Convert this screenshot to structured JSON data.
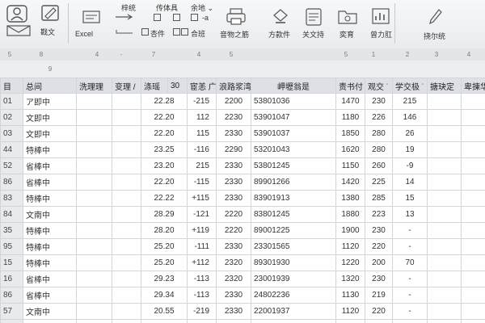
{
  "ribbon": {
    "group_tabs": [
      "梓统",
      "传体具",
      "余地 ⌄"
    ],
    "left_buttons": [
      {
        "label": ""
      },
      {
        "label": "戡文"
      }
    ],
    "excel_label": "Excel",
    "small_controls": [
      "杏件",
      "合班",
      "-a"
    ],
    "buttons": [
      {
        "label": "音物之筋"
      },
      {
        "label": "方款件"
      },
      {
        "label": "关文持"
      },
      {
        "label": "奕育"
      },
      {
        "label": "曾力肛"
      },
      {
        "label": "挠尔统"
      }
    ]
  },
  "index_row": [
    "5",
    "8",
    "4",
    "-",
    "7",
    "4",
    "5",
    "5",
    "1",
    "2",
    "3",
    "4"
  ],
  "col_letters": [
    "9"
  ],
  "table": {
    "headers": [
      "目",
      "总间",
      "洗理理",
      "变理 /",
      "涤瑶",
      "30",
      "宦恙 广",
      "浪路浆湾",
      "岬壢翁是",
      "责书付",
      "观交 ˙",
      "学交极 ˙",
      "搪玦定",
      "卑揀华"
    ],
    "rows": [
      {
        "n": "01",
        "name": "ア即中",
        "a": "22.28",
        "b": "-215",
        "c": "2200",
        "code": "53801036",
        "d": "1470",
        "e": "230",
        "f": "215"
      },
      {
        "n": "02",
        "name": "文即中",
        "a": "22.20",
        "b": "112",
        "c": "2230",
        "code": "53901047",
        "d": "1180",
        "e": "226",
        "f": "146"
      },
      {
        "n": "03",
        "name": "文即中",
        "a": "22.20",
        "b": "115",
        "c": "2330",
        "code": "53901037",
        "d": "1850",
        "e": "280",
        "f": "26"
      },
      {
        "n": "44",
        "name": "特棒中",
        "a": "23.25",
        "b": "-116",
        "c": "2290",
        "code": "53201043",
        "d": "1620",
        "e": "280",
        "f": "19"
      },
      {
        "n": "52",
        "name": "省棒中",
        "a": "23.20",
        "b": "215",
        "c": "2330",
        "code": "53801245",
        "d": "1150",
        "e": "260",
        "f": "-9"
      },
      {
        "n": "86",
        "name": "省棒中",
        "a": "22.20",
        "b": "-115",
        "c": "2330",
        "code": "89901266",
        "d": "1420",
        "e": "225",
        "f": "14"
      },
      {
        "n": "83",
        "name": "特棒中",
        "a": "22.22",
        "b": "+115",
        "c": "2330",
        "code": "83901913",
        "d": "1380",
        "e": "285",
        "f": "15"
      },
      {
        "n": "84",
        "name": "文南中",
        "a": "28.29",
        "b": "-121",
        "c": "2220",
        "code": "83801245",
        "d": "1880",
        "e": "223",
        "f": "13"
      },
      {
        "n": "35",
        "name": "特棒中",
        "a": "28.20",
        "b": "+119",
        "c": "2220",
        "code": "89001225",
        "d": "1900",
        "e": "230",
        "f": "-"
      },
      {
        "n": "95",
        "name": "特棒中",
        "a": "25.20",
        "b": "-111",
        "c": "2330",
        "code": "23301565",
        "d": "1120",
        "e": "220",
        "f": "-"
      },
      {
        "n": "15",
        "name": "特棒中",
        "a": "25.20",
        "b": "+112",
        "c": "2320",
        "code": "89301930",
        "d": "1220",
        "e": "200",
        "f": "70"
      },
      {
        "n": "16",
        "name": "省棒中",
        "a": "29.23",
        "b": "-113",
        "c": "2320",
        "code": "23001939",
        "d": "1320",
        "e": "230",
        "f": "-"
      },
      {
        "n": "86",
        "name": "省棒中",
        "a": "29.34",
        "b": "-113",
        "c": "2330",
        "code": "24802236",
        "d": "1130",
        "e": "219",
        "f": "-"
      },
      {
        "n": "57",
        "name": "文南中",
        "a": "20.55",
        "b": "-219",
        "c": "2330",
        "code": "22001937",
        "d": "1120",
        "e": "220",
        "f": "-"
      },
      {
        "n": "33",
        "name": "省棒中",
        "a": "29.53",
        "b": "-211",
        "c": "2320",
        "code": "24001258",
        "d": "1230",
        "e": "235",
        "f": "-"
      }
    ]
  }
}
